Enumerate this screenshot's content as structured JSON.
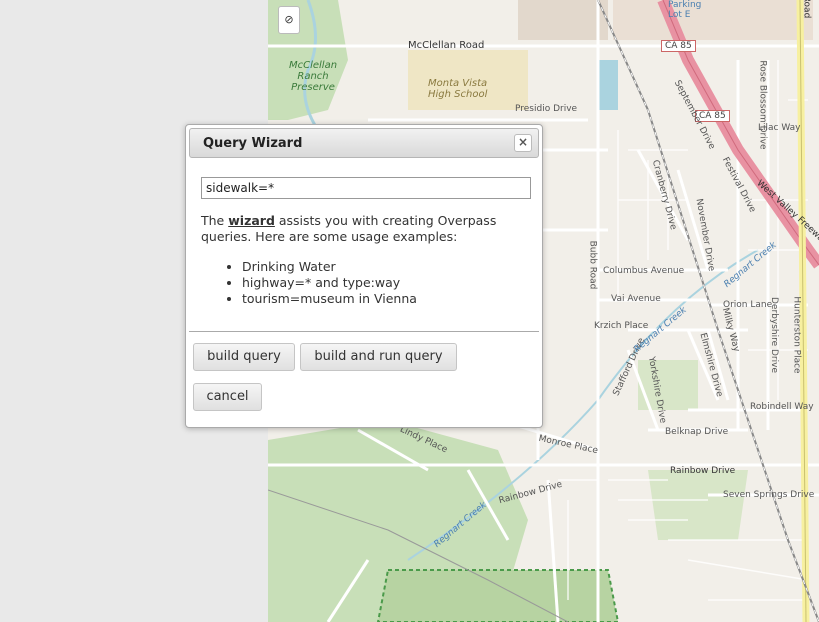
{
  "dialog": {
    "title": "Query Wizard",
    "close_icon": "close-icon",
    "input_value": "sidewalk=*",
    "desc_prefix": "The ",
    "desc_link": "wizard",
    "desc_rest": " assists you with creating Overpass queries. Here are some usage examples:",
    "examples": [
      "Drinking Water",
      "highway=* and type:way",
      "tourism=museum in Vienna"
    ],
    "build_label": "build query",
    "build_run_label": "build and run query",
    "cancel_label": "cancel"
  },
  "map": {
    "control_icon": "no-entry-icon",
    "labels": {
      "mcclellan_road": "McClellan Road",
      "mcclellan_ranch": "McClellan Ranch Preserve",
      "monta_vista": "Monta Vista High School",
      "presidio": "Presidio Drive",
      "parking": "Parking Lot E",
      "ca85a": "CA 85",
      "ca85b": "CA 85",
      "west_valley": "West Valley Freeway",
      "september": "September Drive",
      "festival": "Festival Drive",
      "lilac": "Lilac Way",
      "rose_blossom": "Rose Blossom Drive",
      "bubb": "Bubb Road",
      "columbus": "Columbus Avenue",
      "vai": "Vai Avenue",
      "krzich": "Krzich Place",
      "november": "November Drive",
      "cranberry": "Cranberry Drive",
      "orion": "Orion Lane",
      "derbyshire": "Derbyshire Drive",
      "hunterston": "Hunterston Place",
      "robindell": "Robindell Way",
      "milky": "Milky Way",
      "elmshire": "Elmshire Drive",
      "yorkshire": "Yorkshire Drive",
      "stafford": "Stafford Drive",
      "belknap": "Belknap Drive",
      "monroe": "Monroe Place",
      "rainbow1": "Rainbow Drive",
      "rainbow2": "Rainbow Drive",
      "seven_springs": "Seven Springs Drive",
      "regnart1": "Regnart Creek",
      "regnart2": "Regnart Creek",
      "regnart3": "Regnart Creek",
      "lindy": "Lindy Place",
      "road_top": "Road"
    }
  }
}
